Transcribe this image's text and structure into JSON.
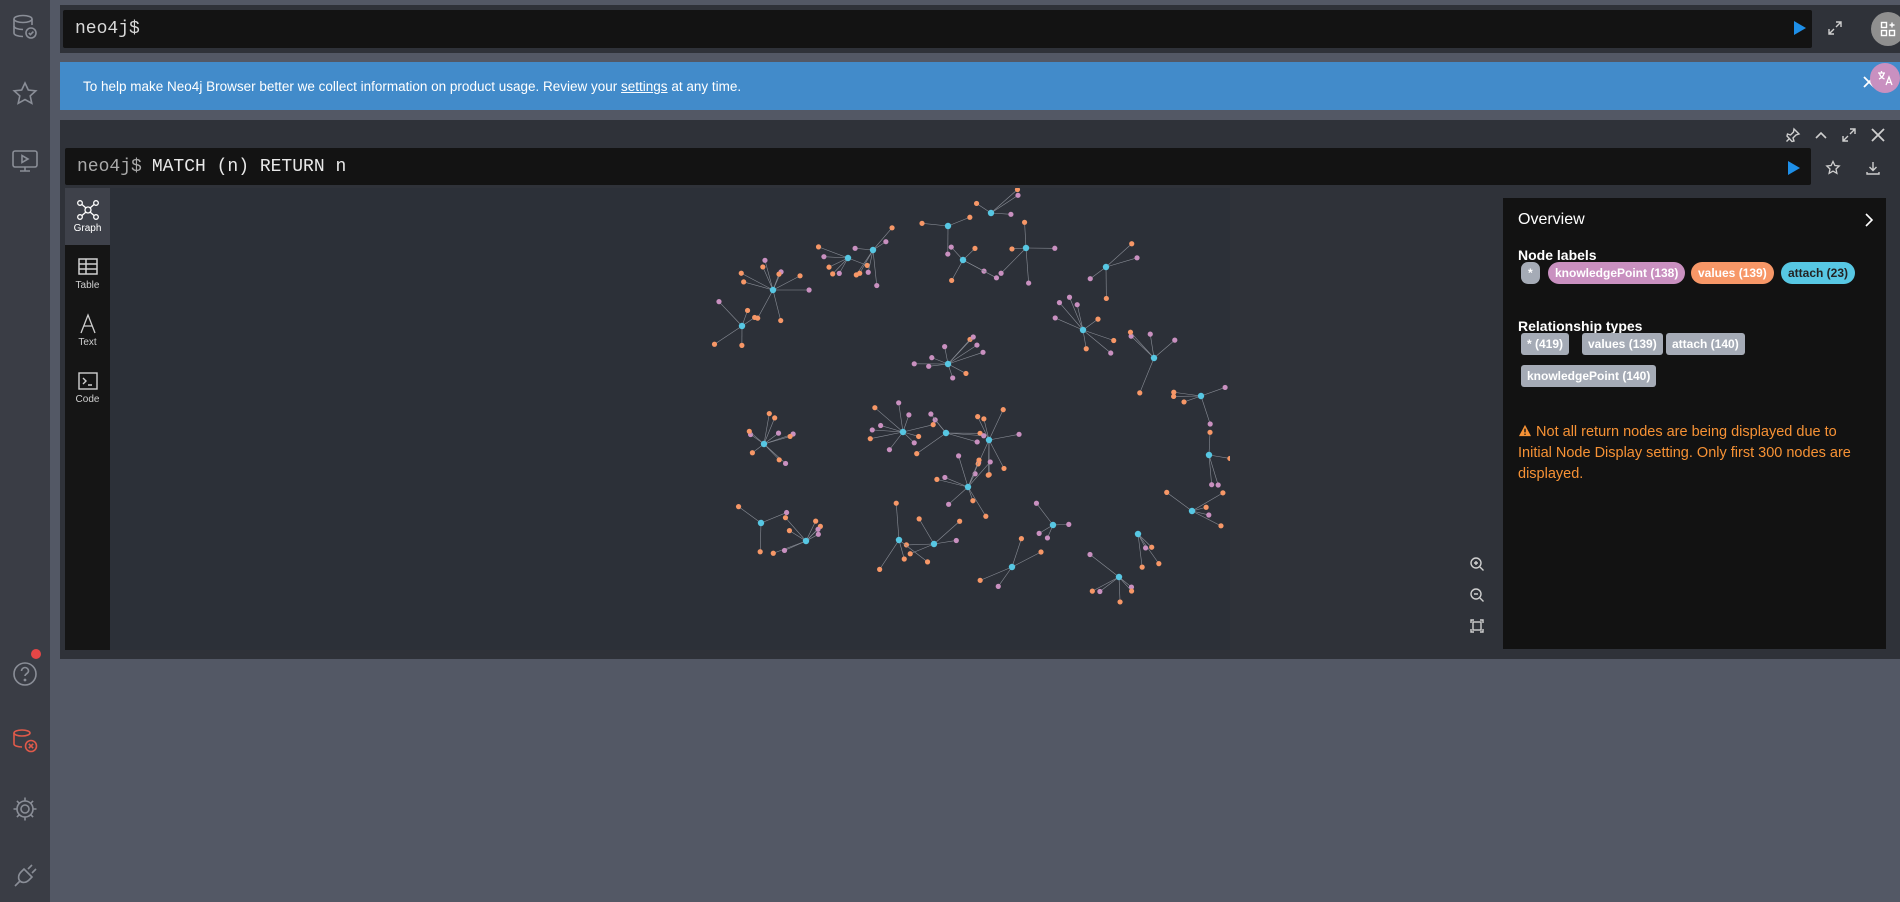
{
  "sidebar": {
    "icons": [
      "database-icon",
      "star-icon",
      "play-guide-icon",
      "help-icon",
      "disconnected-icon",
      "gear-icon",
      "plug-icon"
    ],
    "notification": true
  },
  "editor": {
    "prompt": "neo4j$",
    "value": ""
  },
  "banner": {
    "text_before": "To help make Neo4j Browser better we collect information on product usage. Review your",
    "link": "settings",
    "text_after": "at any time."
  },
  "frame": {
    "prompt": "neo4j$",
    "query": "MATCH (n) RETURN n",
    "tabs": [
      {
        "label": "Graph",
        "icon": "graph-icon",
        "active": true
      },
      {
        "label": "Table",
        "icon": "table-icon",
        "active": false
      },
      {
        "label": "Text",
        "icon": "text-icon",
        "active": false
      },
      {
        "label": "Code",
        "icon": "code-icon",
        "active": false
      }
    ]
  },
  "overview": {
    "title": "Overview",
    "node_labels_heading": "Node labels",
    "node_labels": [
      {
        "label": "*",
        "color": "#a5abb6"
      },
      {
        "label": "knowledgePoint (138)",
        "color": "#c990c0"
      },
      {
        "label": "values (139)",
        "color": "#f79767"
      },
      {
        "label": "attach (23)",
        "color": "#57c7e3"
      }
    ],
    "rel_types_heading": "Relationship types",
    "rel_types": [
      "* (419)",
      "values (139)",
      "attach (140)",
      "knowledgePoint (140)"
    ],
    "warning": "Not all return nodes are being displayed due to Initial Node Display setting. Only first 300 nodes are displayed."
  },
  "colors": {
    "knowledgePoint": "#c990c0",
    "values": "#f79767",
    "attach": "#57c7e3",
    "banner": "#428bca",
    "warning": "#f79235",
    "run": "#1e8fe8"
  }
}
